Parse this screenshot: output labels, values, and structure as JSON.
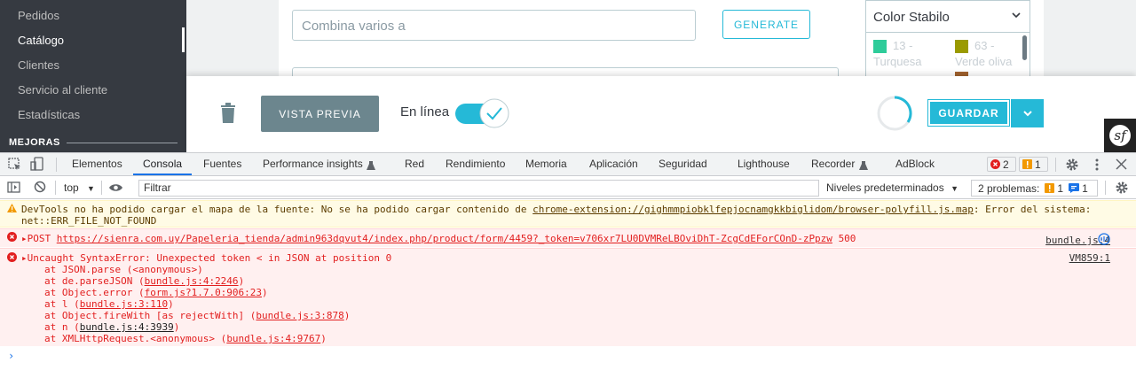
{
  "sidebar": {
    "items": [
      {
        "label": "Pedidos"
      },
      {
        "label": "Catálogo"
      },
      {
        "label": "Clientes"
      },
      {
        "label": "Servicio al cliente"
      },
      {
        "label": "Estadísticas"
      }
    ],
    "section_title": "MEJORAS"
  },
  "form": {
    "combine_placeholder": "Combina varios a",
    "generate_label": "GENERATE",
    "color_select": "Color Stabilo",
    "swatches": [
      {
        "label_line1": "13 -",
        "label_line2": "Turquesa",
        "color": "#2ecc9a"
      },
      {
        "label_line1": "63 -",
        "label_line2": "Verde oliva",
        "color": "#9a9a00"
      }
    ]
  },
  "actions": {
    "preview_label": "VISTA PREVIA",
    "online_label": "En línea",
    "save_label": "GUARDAR"
  },
  "devtools": {
    "tabs": [
      "Elementos",
      "Consola",
      "Fuentes",
      "Performance insights",
      "Red",
      "Rendimiento",
      "Memoria",
      "Aplicación",
      "Seguridad",
      "Lighthouse",
      "Recorder",
      "AdBlock"
    ],
    "active_tab": "Consola",
    "error_count": "2",
    "warning_count": "1",
    "context": "top",
    "filter_placeholder": "Filtrar",
    "levels": "Niveles predeterminados",
    "issues_label": "2 problemas:",
    "issues_warn": "1",
    "issues_info": "1"
  },
  "console": {
    "warning": {
      "line1_prefix": "DevTools no ha podido cargar el mapa de la fuente: No se ha podido cargar contenido de ",
      "line1_link": "chrome-extension://gighmmpiobklfepjocnamgkkbiglidom/browser-polyfill.js.map",
      "line1_suffix": ": Error del sistema:",
      "line2": "net::ERR_FILE_NOT_FOUND"
    },
    "post_error": {
      "method": "POST",
      "url": "https://sienra.com.uy/Papeleria_tienda/admin963dqvut4/index.php/product/form/4459?_token=v706xr7LU0DVMReLBOviDhT-ZcgCdEForCOnD-zPpzw",
      "status": "500",
      "source": "bundle.js:4"
    },
    "syntax_error": {
      "message": "Uncaught SyntaxError: Unexpected token < in JSON at position 0",
      "source": "VM859:1",
      "stack": [
        {
          "text": "at JSON.parse (<anonymous>)",
          "link": ""
        },
        {
          "text": "at de.parseJSON (",
          "link": "bundle.js:4:2246",
          "end": ")"
        },
        {
          "text": "at Object.error (",
          "link": "form.js?1.7.0:906:23",
          "end": ")"
        },
        {
          "text": "at l (",
          "link": "bundle.js:3:110",
          "end": ")"
        },
        {
          "text": "at Object.fireWith [as rejectWith] (",
          "link": "bundle.js:3:878",
          "end": ")"
        },
        {
          "text": "at n (",
          "link": "bundle.js:4:3939",
          "end": ")"
        },
        {
          "text": "at XMLHttpRequest.<anonymous> (",
          "link": "bundle.js:4:9767",
          "end": ")"
        }
      ]
    },
    "prompt": "›"
  }
}
